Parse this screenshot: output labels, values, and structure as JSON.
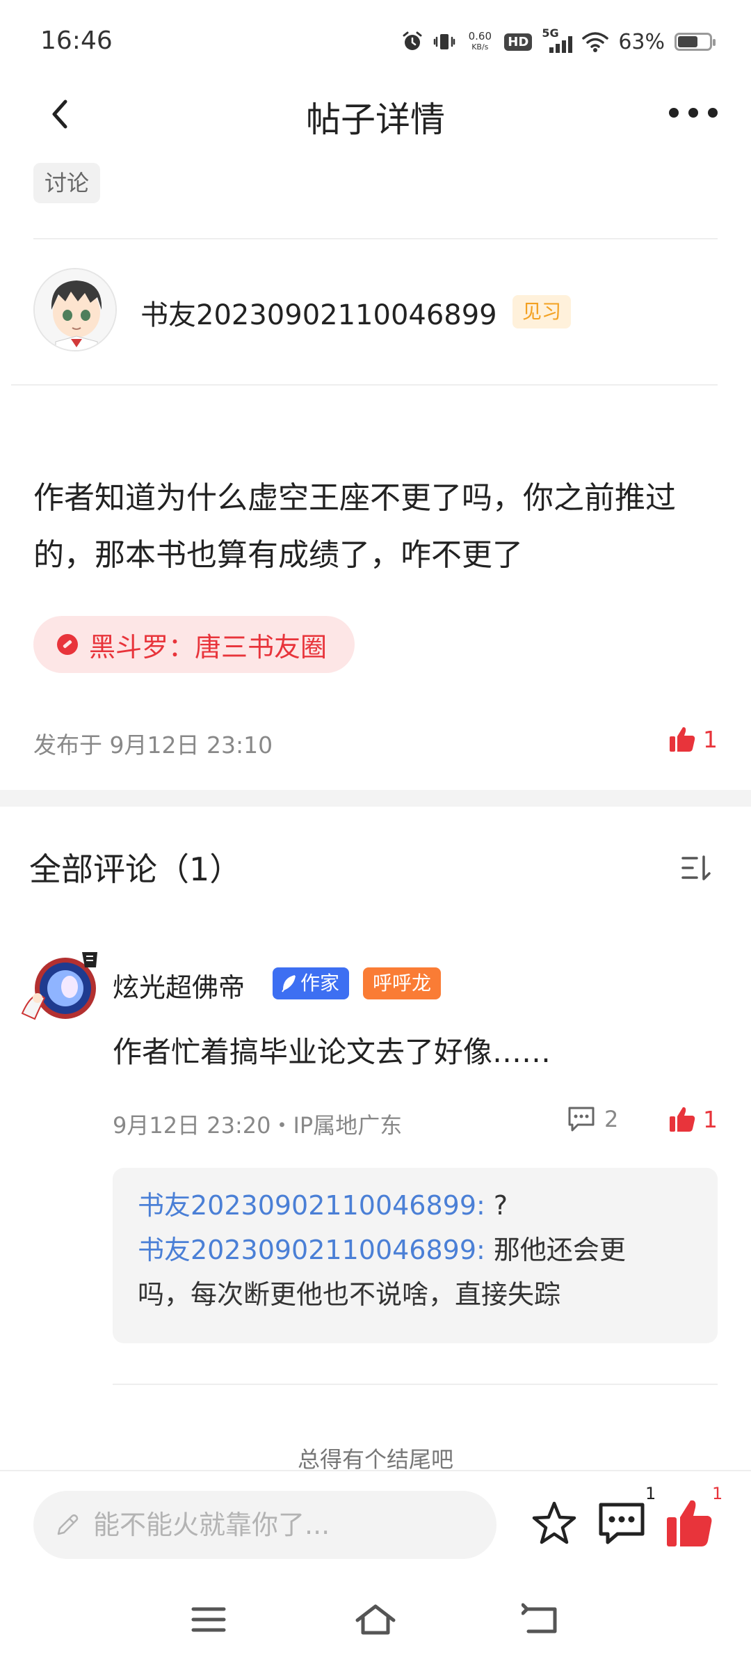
{
  "status_bar": {
    "time": "16:46",
    "net_speed_value": "0.60",
    "net_speed_unit": "KB/s",
    "hd_label": "HD",
    "network": "5G",
    "battery_text": "63%",
    "battery_level": 0.63
  },
  "nav": {
    "title": "帖子详情"
  },
  "post": {
    "tag": "讨论",
    "author_name": "书友20230902110046899",
    "author_level": "见习",
    "body": "作者知道为什么虚空王座不更了吗，你之前推过的，那本书也算有成绩了，咋不更了",
    "circle": "黑斗罗：唐三书友圈",
    "published": "发布于 9月12日 23:10",
    "likes": "1"
  },
  "comments": {
    "title": "全部评论（1）",
    "items": [
      {
        "user": "炫光超佛帝",
        "badge_writer": "作家",
        "badge_fan": "呼呼龙",
        "text": "作者忙着搞毕业论文去了好像……",
        "meta": "9月12日 23:20・IP属地广东",
        "reply_count": "2",
        "likes": "1",
        "replies": [
          {
            "user": "书友20230902110046899:",
            "text": " ?"
          },
          {
            "user": "书友20230902110046899:",
            "text": " 那他还会更",
            "text_cont": "吗，每次断更他也不说啥，直接失踪"
          }
        ]
      }
    ],
    "next_preview": "总得有个结尾吧"
  },
  "bottom_bar": {
    "input_placeholder": "能不能火就靠你了...",
    "comment_count": "1",
    "like_count": "1"
  },
  "colors": {
    "accent_red": "#e8343b",
    "writer_blue": "#3d6ff2",
    "fan_orange": "#fa7c35",
    "level_orange": "#f3a122",
    "reply_user_blue": "#4a7fd6"
  }
}
